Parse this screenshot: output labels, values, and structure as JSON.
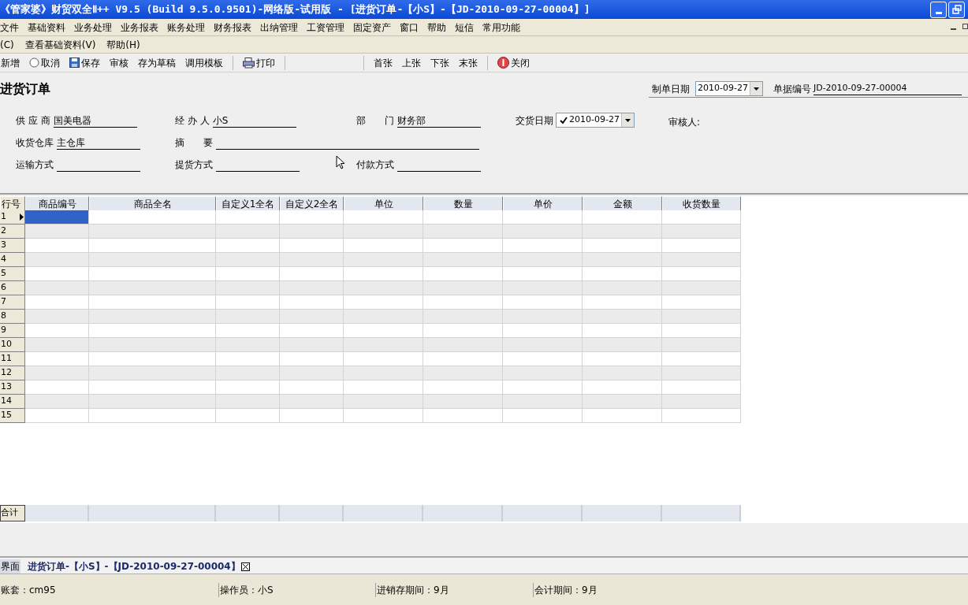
{
  "window": {
    "title": "《管家婆》财贸双全Ⅱ++ V9.5 (Build 9.5.0.9501)-网络版-试用版 - [进货订单-【小S】-【JD-2010-09-27-00004】]"
  },
  "main_menu": [
    "文件",
    "基础资料",
    "业务处理",
    "业务报表",
    "账务处理",
    "财务报表",
    "出纳管理",
    "工资管理",
    "固定资产",
    "窗口",
    "帮助",
    "短信",
    "常用功能"
  ],
  "sub_menu": [
    "(C)",
    "查看基础资料(V)",
    "帮助(H)"
  ],
  "toolbar": [
    {
      "kind": "button",
      "label": "新增"
    },
    {
      "kind": "radio",
      "label": "取消"
    },
    {
      "kind": "save",
      "label": "保存"
    },
    {
      "kind": "button",
      "label": "审核"
    },
    {
      "kind": "button",
      "label": "存为草稿"
    },
    {
      "kind": "button",
      "label": "调用模板"
    },
    {
      "kind": "separator"
    },
    {
      "kind": "print",
      "label": "打印"
    },
    {
      "kind": "separator"
    },
    {
      "kind": "gap"
    },
    {
      "kind": "separator"
    },
    {
      "kind": "button",
      "label": "首张"
    },
    {
      "kind": "button",
      "label": "上张"
    },
    {
      "kind": "button",
      "label": "下张"
    },
    {
      "kind": "button",
      "label": "末张"
    },
    {
      "kind": "separator"
    },
    {
      "kind": "stop",
      "label": "关闭"
    }
  ],
  "form": {
    "title": "进货订单",
    "date": {
      "label": "制单日期",
      "value": "2010-09-27"
    },
    "number": {
      "label": "单据编号",
      "value": "JD-2010-09-27-00004"
    },
    "rows": [
      [
        {
          "label": "供 应 商",
          "value": "国美电器"
        },
        {
          "label": "经 办 人",
          "value": "小S"
        },
        {
          "label": "部　　门",
          "value": "财务部"
        }
      ],
      [
        {
          "label": "收货仓库",
          "value": "主仓库"
        },
        {
          "label": "摘　　要"
        }
      ],
      [
        {
          "label": "运输方式"
        },
        {
          "label": "提货方式"
        },
        {
          "label": "付款方式"
        }
      ]
    ],
    "delivery": {
      "label": "交货日期",
      "value": "2010-09-27",
      "checked": true
    },
    "auditor": {
      "label": "审核人:"
    }
  },
  "grid": {
    "columns": [
      "行号",
      "商品编号",
      "商品全名",
      "自定义1全名",
      "自定义2全名",
      "单位",
      "数量",
      "单价",
      "金额",
      "收货数量"
    ],
    "rows": [
      {
        "number": "1",
        "selected": true
      },
      {
        "number": "2",
        "selected": false
      },
      {
        "number": "3",
        "selected": false
      },
      {
        "number": "4",
        "selected": false
      },
      {
        "number": "5",
        "selected": false
      },
      {
        "number": "6",
        "selected": false
      },
      {
        "number": "7",
        "selected": false
      },
      {
        "number": "8",
        "selected": false
      },
      {
        "number": "9",
        "selected": false
      },
      {
        "number": "10",
        "selected": false
      },
      {
        "number": "11",
        "selected": false
      },
      {
        "number": "12",
        "selected": false
      },
      {
        "number": "13",
        "selected": false
      },
      {
        "number": "14",
        "selected": false
      },
      {
        "number": "15",
        "selected": false
      }
    ],
    "total_label": "合计"
  },
  "tabs": [
    {
      "label": "界面",
      "selected": false
    },
    {
      "label": "进货订单-【小S】-【JD-2010-09-27-00004】",
      "selected": true
    }
  ],
  "status_bar": [
    "账套：cm95",
    "操作员：小S",
    "进销存期间：9月",
    "会计期间：9月"
  ]
}
